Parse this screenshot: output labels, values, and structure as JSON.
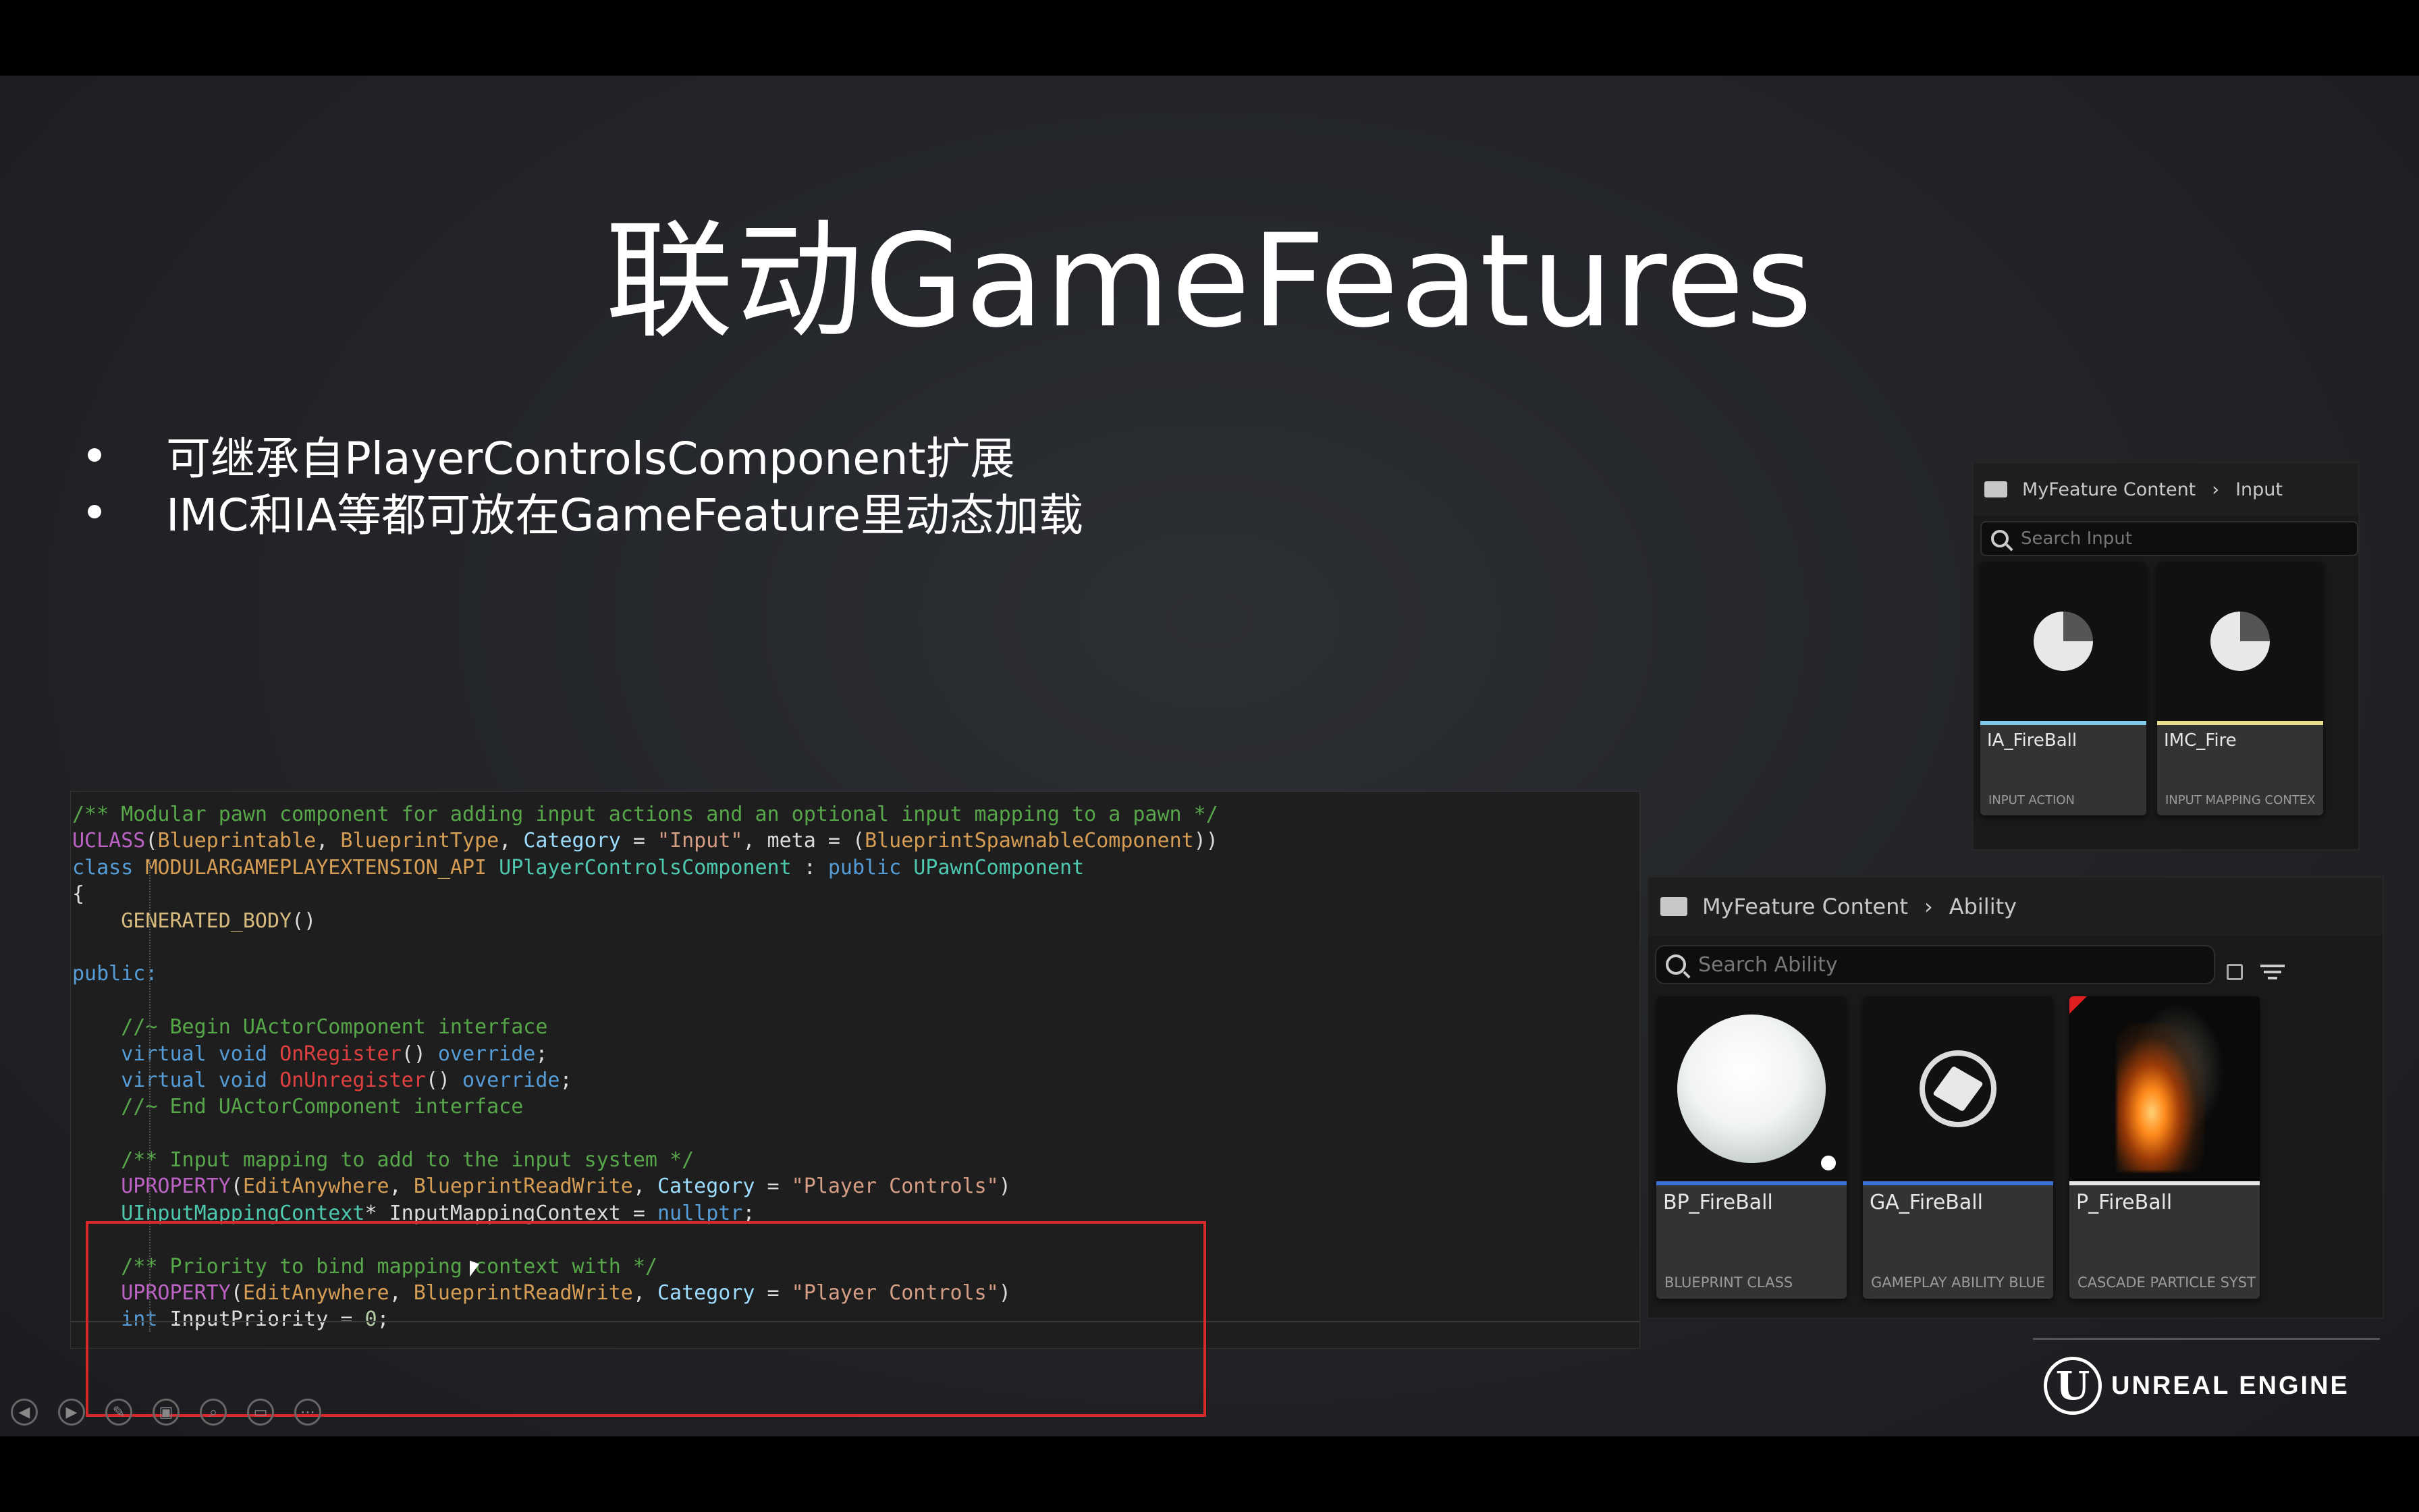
{
  "slide": {
    "title": "联动GameFeatures",
    "bullets": [
      "可继承自PlayerControlsComponent扩展",
      "IMC和IA等都可放在GameFeature里动态加载"
    ]
  },
  "code": {
    "lines": [
      [
        {
          "t": "/** Modular pawn component for adding input actions and an optional input mapping to a pawn */",
          "c": "com"
        }
      ],
      [
        {
          "t": "UCLASS",
          "c": "mac"
        },
        {
          "t": "(",
          "c": ""
        },
        {
          "t": "Blueprintable",
          "c": "org"
        },
        {
          "t": ", ",
          "c": ""
        },
        {
          "t": "BlueprintType",
          "c": "org"
        },
        {
          "t": ", ",
          "c": ""
        },
        {
          "t": "Category",
          "c": "prop"
        },
        {
          "t": " = ",
          "c": ""
        },
        {
          "t": "\"Input\"",
          "c": "str"
        },
        {
          "t": ", meta = (",
          "c": ""
        },
        {
          "t": "BlueprintSpawnableComponent",
          "c": "org"
        },
        {
          "t": "))",
          "c": ""
        }
      ],
      [
        {
          "t": "class ",
          "c": "kw"
        },
        {
          "t": "MODULARGAMEPLAYEXTENSION_API",
          "c": "org"
        },
        {
          "t": " ",
          "c": ""
        },
        {
          "t": "UPlayerControlsComponent",
          "c": "type"
        },
        {
          "t": " : ",
          "c": ""
        },
        {
          "t": "public ",
          "c": "kw"
        },
        {
          "t": "UPawnComponent",
          "c": "type"
        }
      ],
      [
        {
          "t": "{",
          "c": ""
        }
      ],
      [
        {
          "t": "    ",
          "c": ""
        },
        {
          "t": "GENERATED_BODY",
          "c": "macy"
        },
        {
          "t": "()",
          "c": ""
        }
      ],
      [
        {
          "t": "",
          "c": ""
        }
      ],
      [
        {
          "t": "public:",
          "c": "kw"
        }
      ],
      [
        {
          "t": "",
          "c": ""
        }
      ],
      [
        {
          "t": "    //~ Begin UActorComponent interface",
          "c": "com"
        }
      ],
      [
        {
          "t": "    ",
          "c": ""
        },
        {
          "t": "virtual void ",
          "c": "kw"
        },
        {
          "t": "OnRegister",
          "c": "red"
        },
        {
          "t": "() ",
          "c": ""
        },
        {
          "t": "override",
          "c": "kw"
        },
        {
          "t": ";",
          "c": ""
        }
      ],
      [
        {
          "t": "    ",
          "c": ""
        },
        {
          "t": "virtual void ",
          "c": "kw"
        },
        {
          "t": "OnUnregister",
          "c": "red"
        },
        {
          "t": "() ",
          "c": ""
        },
        {
          "t": "override",
          "c": "kw"
        },
        {
          "t": ";",
          "c": ""
        }
      ],
      [
        {
          "t": "    //~ End UActorComponent interface",
          "c": "com"
        }
      ],
      [
        {
          "t": "",
          "c": ""
        }
      ],
      [
        {
          "t": "    /** Input mapping to add to the input system */",
          "c": "com"
        }
      ],
      [
        {
          "t": "    ",
          "c": ""
        },
        {
          "t": "UPROPERTY",
          "c": "mac"
        },
        {
          "t": "(",
          "c": ""
        },
        {
          "t": "EditAnywhere",
          "c": "org"
        },
        {
          "t": ", ",
          "c": ""
        },
        {
          "t": "BlueprintReadWrite",
          "c": "org"
        },
        {
          "t": ", ",
          "c": ""
        },
        {
          "t": "Category",
          "c": "prop"
        },
        {
          "t": " = ",
          "c": ""
        },
        {
          "t": "\"Player Controls\"",
          "c": "str"
        },
        {
          "t": ")",
          "c": ""
        }
      ],
      [
        {
          "t": "    ",
          "c": ""
        },
        {
          "t": "UInputMappingContext",
          "c": "type"
        },
        {
          "t": "* InputMappingContext = ",
          "c": ""
        },
        {
          "t": "nullptr",
          "c": "kw"
        },
        {
          "t": ";",
          "c": ""
        }
      ],
      [
        {
          "t": "",
          "c": ""
        }
      ],
      [
        {
          "t": "    /** Priority to bind mapping context with */",
          "c": "com"
        }
      ],
      [
        {
          "t": "    ",
          "c": ""
        },
        {
          "t": "UPROPERTY",
          "c": "mac"
        },
        {
          "t": "(",
          "c": ""
        },
        {
          "t": "EditAnywhere",
          "c": "org"
        },
        {
          "t": ", ",
          "c": ""
        },
        {
          "t": "BlueprintReadWrite",
          "c": "org"
        },
        {
          "t": ", ",
          "c": ""
        },
        {
          "t": "Category",
          "c": "prop"
        },
        {
          "t": " = ",
          "c": ""
        },
        {
          "t": "\"Player Controls\"",
          "c": "str"
        },
        {
          "t": ")",
          "c": ""
        }
      ],
      [
        {
          "t": "    ",
          "c": ""
        },
        {
          "t": "int ",
          "c": "kw"
        },
        {
          "t": "InputPriority = ",
          "c": ""
        },
        {
          "t": "0",
          "c": "num"
        },
        {
          "t": ";",
          "c": ""
        }
      ]
    ]
  },
  "input_browser": {
    "breadcrumb_root": "MyFeature Content",
    "breadcrumb_leaf": "Input",
    "search_placeholder": "Search Input",
    "assets": [
      {
        "name": "IA_FireBall",
        "type": "INPUT ACTION",
        "underline": "#7fc8e8"
      },
      {
        "name": "IMC_Fire",
        "type": "INPUT MAPPING CONTEX",
        "underline": "#e8e08a"
      }
    ]
  },
  "ability_browser": {
    "breadcrumb_root": "MyFeature Content",
    "breadcrumb_leaf": "Ability",
    "search_placeholder": "Search Ability",
    "assets": [
      {
        "name": "BP_FireBall",
        "type": "BLUEPRINT CLASS",
        "underline": "#3d6fd8",
        "thumb": "sphere"
      },
      {
        "name": "GA_FireBall",
        "type": "GAMEPLAY ABILITY BLUE",
        "underline": "#3d6fd8",
        "thumb": "cube-icon"
      },
      {
        "name": "P_FireBall",
        "type": "CASCADE PARTICLE SYST",
        "underline": "#e6e6e6",
        "thumb": "fire"
      }
    ]
  },
  "brand": {
    "logo_letter": "U",
    "text": "UNREAL ENGINE"
  },
  "player_controls": [
    "prev-icon",
    "next-icon",
    "pen-icon",
    "pages-icon",
    "zoom-icon",
    "subtitles-icon",
    "more-icon"
  ],
  "colors": {
    "highlight_box": "#d42a2a",
    "code_bg": "#1e1e1e"
  }
}
